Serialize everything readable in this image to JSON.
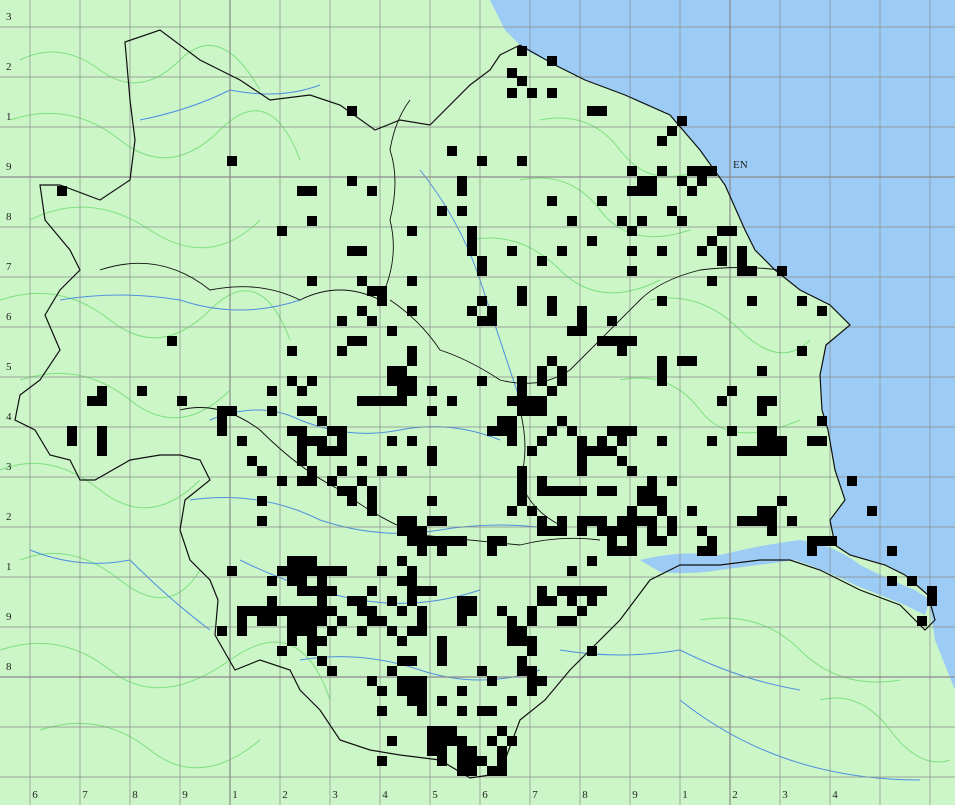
{
  "map": {
    "colors": {
      "land": "#ccf5c8",
      "sea": "#9cccf5",
      "contour": "#7fe07f",
      "river": "#4f8fe0",
      "grid": "#8a8a8a",
      "boundary": "#111111",
      "record": "#000000"
    },
    "x_ticks": [
      "6",
      "7",
      "8",
      "9",
      "1",
      "2",
      "3",
      "4",
      "5",
      "6",
      "7",
      "8",
      "9",
      "1",
      "2",
      "3",
      "4"
    ],
    "y_ticks": [
      "3",
      "2",
      "1",
      "9",
      "8",
      "7",
      "6",
      "5",
      "4",
      "3",
      "2",
      "1",
      "9",
      "8"
    ],
    "sea_label": "EN"
  },
  "records": [
    [
      522,
      51
    ],
    [
      552,
      61
    ],
    [
      512,
      73
    ],
    [
      522,
      81
    ],
    [
      512,
      93
    ],
    [
      532,
      93
    ],
    [
      552,
      93
    ],
    [
      352,
      111
    ],
    [
      592,
      111
    ],
    [
      602,
      111
    ],
    [
      682,
      121
    ],
    [
      672,
      131
    ],
    [
      662,
      141
    ],
    [
      452,
      151
    ],
    [
      232,
      161
    ],
    [
      482,
      161
    ],
    [
      522,
      161
    ],
    [
      632,
      171
    ],
    [
      662,
      171
    ],
    [
      692,
      171
    ],
    [
      702,
      171
    ],
    [
      712,
      171
    ],
    [
      352,
      181
    ],
    [
      462,
      181
    ],
    [
      642,
      181
    ],
    [
      652,
      181
    ],
    [
      682,
      181
    ],
    [
      702,
      181
    ],
    [
      62,
      191
    ],
    [
      302,
      191
    ],
    [
      312,
      191
    ],
    [
      372,
      191
    ],
    [
      462,
      191
    ],
    [
      632,
      191
    ],
    [
      642,
      191
    ],
    [
      652,
      191
    ],
    [
      692,
      191
    ],
    [
      552,
      201
    ],
    [
      602,
      201
    ],
    [
      462,
      211
    ],
    [
      442,
      211
    ],
    [
      672,
      211
    ],
    [
      312,
      221
    ],
    [
      572,
      221
    ],
    [
      622,
      221
    ],
    [
      642,
      221
    ],
    [
      682,
      221
    ],
    [
      412,
      231
    ],
    [
      282,
      231
    ],
    [
      472,
      231
    ],
    [
      722,
      231
    ],
    [
      732,
      231
    ],
    [
      632,
      231
    ],
    [
      592,
      241
    ],
    [
      472,
      241
    ],
    [
      712,
      241
    ],
    [
      352,
      251
    ],
    [
      362,
      251
    ],
    [
      472,
      251
    ],
    [
      512,
      251
    ],
    [
      562,
      251
    ],
    [
      632,
      251
    ],
    [
      662,
      251
    ],
    [
      702,
      251
    ],
    [
      722,
      251
    ],
    [
      742,
      251
    ],
    [
      482,
      261
    ],
    [
      542,
      261
    ],
    [
      722,
      261
    ],
    [
      742,
      261
    ],
    [
      482,
      271
    ],
    [
      632,
      271
    ],
    [
      742,
      271
    ],
    [
      752,
      271
    ],
    [
      782,
      271
    ],
    [
      362,
      281
    ],
    [
      312,
      281
    ],
    [
      712,
      281
    ],
    [
      412,
      281
    ],
    [
      372,
      291
    ],
    [
      382,
      291
    ],
    [
      522,
      291
    ],
    [
      382,
      301
    ],
    [
      482,
      301
    ],
    [
      522,
      301
    ],
    [
      552,
      301
    ],
    [
      752,
      301
    ],
    [
      802,
      301
    ],
    [
      662,
      301
    ],
    [
      362,
      311
    ],
    [
      412,
      311
    ],
    [
      472,
      311
    ],
    [
      492,
      311
    ],
    [
      552,
      311
    ],
    [
      582,
      311
    ],
    [
      822,
      311
    ],
    [
      342,
      321
    ],
    [
      372,
      321
    ],
    [
      482,
      321
    ],
    [
      492,
      321
    ],
    [
      582,
      321
    ],
    [
      612,
      321
    ],
    [
      392,
      331
    ],
    [
      572,
      331
    ],
    [
      582,
      331
    ],
    [
      352,
      341
    ],
    [
      362,
      341
    ],
    [
      602,
      341
    ],
    [
      612,
      341
    ],
    [
      622,
      341
    ],
    [
      632,
      341
    ],
    [
      172,
      341
    ],
    [
      292,
      351
    ],
    [
      342,
      351
    ],
    [
      412,
      351
    ],
    [
      622,
      351
    ],
    [
      802,
      351
    ],
    [
      412,
      361
    ],
    [
      552,
      361
    ],
    [
      662,
      361
    ],
    [
      682,
      361
    ],
    [
      692,
      361
    ],
    [
      392,
      371
    ],
    [
      402,
      371
    ],
    [
      542,
      371
    ],
    [
      562,
      371
    ],
    [
      662,
      371
    ],
    [
      762,
      371
    ],
    [
      292,
      381
    ],
    [
      312,
      381
    ],
    [
      392,
      381
    ],
    [
      402,
      381
    ],
    [
      412,
      381
    ],
    [
      482,
      381
    ],
    [
      522,
      381
    ],
    [
      542,
      381
    ],
    [
      562,
      381
    ],
    [
      662,
      381
    ],
    [
      102,
      391
    ],
    [
      142,
      391
    ],
    [
      272,
      391
    ],
    [
      302,
      391
    ],
    [
      402,
      391
    ],
    [
      412,
      391
    ],
    [
      432,
      391
    ],
    [
      522,
      391
    ],
    [
      552,
      391
    ],
    [
      732,
      391
    ],
    [
      92,
      401
    ],
    [
      102,
      401
    ],
    [
      182,
      401
    ],
    [
      362,
      401
    ],
    [
      372,
      401
    ],
    [
      382,
      401
    ],
    [
      392,
      401
    ],
    [
      402,
      401
    ],
    [
      452,
      401
    ],
    [
      512,
      401
    ],
    [
      522,
      401
    ],
    [
      532,
      401
    ],
    [
      542,
      401
    ],
    [
      722,
      401
    ],
    [
      762,
      401
    ],
    [
      772,
      401
    ],
    [
      222,
      411
    ],
    [
      232,
      411
    ],
    [
      272,
      411
    ],
    [
      302,
      411
    ],
    [
      312,
      411
    ],
    [
      432,
      411
    ],
    [
      522,
      411
    ],
    [
      532,
      411
    ],
    [
      542,
      411
    ],
    [
      762,
      411
    ],
    [
      222,
      421
    ],
    [
      322,
      421
    ],
    [
      502,
      421
    ],
    [
      512,
      421
    ],
    [
      562,
      421
    ],
    [
      822,
      421
    ],
    [
      222,
      431
    ],
    [
      292,
      431
    ],
    [
      302,
      431
    ],
    [
      332,
      431
    ],
    [
      342,
      431
    ],
    [
      492,
      431
    ],
    [
      502,
      431
    ],
    [
      512,
      431
    ],
    [
      552,
      431
    ],
    [
      572,
      431
    ],
    [
      612,
      431
    ],
    [
      622,
      431
    ],
    [
      632,
      431
    ],
    [
      732,
      431
    ],
    [
      762,
      431
    ],
    [
      772,
      431
    ],
    [
      72,
      431
    ],
    [
      102,
      431
    ],
    [
      72,
      441
    ],
    [
      102,
      441
    ],
    [
      242,
      441
    ],
    [
      302,
      441
    ],
    [
      312,
      441
    ],
    [
      322,
      441
    ],
    [
      342,
      441
    ],
    [
      392,
      441
    ],
    [
      412,
      441
    ],
    [
      512,
      441
    ],
    [
      542,
      441
    ],
    [
      582,
      441
    ],
    [
      602,
      441
    ],
    [
      622,
      441
    ],
    [
      662,
      441
    ],
    [
      712,
      441
    ],
    [
      762,
      441
    ],
    [
      772,
      441
    ],
    [
      782,
      441
    ],
    [
      812,
      441
    ],
    [
      822,
      441
    ],
    [
      102,
      451
    ],
    [
      302,
      451
    ],
    [
      322,
      451
    ],
    [
      332,
      451
    ],
    [
      342,
      451
    ],
    [
      432,
      451
    ],
    [
      532,
      451
    ],
    [
      582,
      451
    ],
    [
      592,
      451
    ],
    [
      602,
      451
    ],
    [
      612,
      451
    ],
    [
      742,
      451
    ],
    [
      752,
      451
    ],
    [
      762,
      451
    ],
    [
      772,
      451
    ],
    [
      782,
      451
    ],
    [
      252,
      461
    ],
    [
      302,
      461
    ],
    [
      362,
      461
    ],
    [
      432,
      461
    ],
    [
      582,
      461
    ],
    [
      622,
      461
    ],
    [
      262,
      471
    ],
    [
      312,
      471
    ],
    [
      342,
      471
    ],
    [
      382,
      471
    ],
    [
      402,
      471
    ],
    [
      522,
      471
    ],
    [
      582,
      471
    ],
    [
      632,
      471
    ],
    [
      282,
      481
    ],
    [
      302,
      481
    ],
    [
      312,
      481
    ],
    [
      332,
      481
    ],
    [
      362,
      481
    ],
    [
      522,
      481
    ],
    [
      542,
      481
    ],
    [
      652,
      481
    ],
    [
      672,
      481
    ],
    [
      852,
      481
    ],
    [
      342,
      491
    ],
    [
      352,
      491
    ],
    [
      372,
      491
    ],
    [
      522,
      491
    ],
    [
      542,
      491
    ],
    [
      552,
      491
    ],
    [
      562,
      491
    ],
    [
      572,
      491
    ],
    [
      582,
      491
    ],
    [
      602,
      491
    ],
    [
      612,
      491
    ],
    [
      642,
      491
    ],
    [
      652,
      491
    ],
    [
      262,
      501
    ],
    [
      352,
      501
    ],
    [
      372,
      501
    ],
    [
      432,
      501
    ],
    [
      522,
      501
    ],
    [
      642,
      501
    ],
    [
      652,
      501
    ],
    [
      662,
      501
    ],
    [
      782,
      501
    ],
    [
      372,
      511
    ],
    [
      512,
      511
    ],
    [
      532,
      511
    ],
    [
      632,
      511
    ],
    [
      662,
      511
    ],
    [
      692,
      511
    ],
    [
      762,
      511
    ],
    [
      772,
      511
    ],
    [
      872,
      511
    ],
    [
      262,
      521
    ],
    [
      402,
      521
    ],
    [
      412,
      521
    ],
    [
      432,
      521
    ],
    [
      442,
      521
    ],
    [
      542,
      521
    ],
    [
      562,
      521
    ],
    [
      582,
      521
    ],
    [
      592,
      521
    ],
    [
      602,
      521
    ],
    [
      622,
      521
    ],
    [
      632,
      521
    ],
    [
      642,
      521
    ],
    [
      652,
      521
    ],
    [
      672,
      521
    ],
    [
      742,
      521
    ],
    [
      752,
      521
    ],
    [
      762,
      521
    ],
    [
      772,
      521
    ],
    [
      792,
      521
    ],
    [
      402,
      531
    ],
    [
      412,
      531
    ],
    [
      422,
      531
    ],
    [
      542,
      531
    ],
    [
      552,
      531
    ],
    [
      562,
      531
    ],
    [
      582,
      531
    ],
    [
      602,
      531
    ],
    [
      612,
      531
    ],
    [
      622,
      531
    ],
    [
      632,
      531
    ],
    [
      652,
      531
    ],
    [
      672,
      531
    ],
    [
      702,
      531
    ],
    [
      772,
      531
    ],
    [
      412,
      541
    ],
    [
      422,
      541
    ],
    [
      432,
      541
    ],
    [
      442,
      541
    ],
    [
      452,
      541
    ],
    [
      462,
      541
    ],
    [
      492,
      541
    ],
    [
      502,
      541
    ],
    [
      612,
      541
    ],
    [
      632,
      541
    ],
    [
      652,
      541
    ],
    [
      662,
      541
    ],
    [
      712,
      541
    ],
    [
      812,
      541
    ],
    [
      822,
      541
    ],
    [
      832,
      541
    ],
    [
      422,
      551
    ],
    [
      442,
      551
    ],
    [
      492,
      551
    ],
    [
      612,
      551
    ],
    [
      622,
      551
    ],
    [
      632,
      551
    ],
    [
      702,
      551
    ],
    [
      712,
      551
    ],
    [
      812,
      551
    ],
    [
      892,
      551
    ],
    [
      292,
      561
    ],
    [
      302,
      561
    ],
    [
      312,
      561
    ],
    [
      402,
      561
    ],
    [
      592,
      561
    ],
    [
      232,
      571
    ],
    [
      282,
      571
    ],
    [
      292,
      571
    ],
    [
      302,
      571
    ],
    [
      312,
      571
    ],
    [
      322,
      571
    ],
    [
      332,
      571
    ],
    [
      342,
      571
    ],
    [
      382,
      571
    ],
    [
      412,
      571
    ],
    [
      572,
      571
    ],
    [
      272,
      581
    ],
    [
      292,
      581
    ],
    [
      302,
      581
    ],
    [
      322,
      581
    ],
    [
      402,
      581
    ],
    [
      412,
      581
    ],
    [
      892,
      581
    ],
    [
      912,
      581
    ],
    [
      302,
      591
    ],
    [
      312,
      591
    ],
    [
      322,
      591
    ],
    [
      332,
      591
    ],
    [
      372,
      591
    ],
    [
      412,
      591
    ],
    [
      422,
      591
    ],
    [
      432,
      591
    ],
    [
      542,
      591
    ],
    [
      562,
      591
    ],
    [
      572,
      591
    ],
    [
      582,
      591
    ],
    [
      592,
      591
    ],
    [
      602,
      591
    ],
    [
      932,
      591
    ],
    [
      272,
      601
    ],
    [
      322,
      601
    ],
    [
      352,
      601
    ],
    [
      362,
      601
    ],
    [
      392,
      601
    ],
    [
      412,
      601
    ],
    [
      462,
      601
    ],
    [
      472,
      601
    ],
    [
      542,
      601
    ],
    [
      552,
      601
    ],
    [
      572,
      601
    ],
    [
      592,
      601
    ],
    [
      932,
      601
    ],
    [
      242,
      611
    ],
    [
      252,
      611
    ],
    [
      262,
      611
    ],
    [
      272,
      611
    ],
    [
      282,
      611
    ],
    [
      292,
      611
    ],
    [
      302,
      611
    ],
    [
      312,
      611
    ],
    [
      322,
      611
    ],
    [
      332,
      611
    ],
    [
      362,
      611
    ],
    [
      372,
      611
    ],
    [
      402,
      611
    ],
    [
      422,
      611
    ],
    [
      462,
      611
    ],
    [
      472,
      611
    ],
    [
      502,
      611
    ],
    [
      532,
      611
    ],
    [
      582,
      611
    ],
    [
      242,
      621
    ],
    [
      262,
      621
    ],
    [
      272,
      621
    ],
    [
      292,
      621
    ],
    [
      302,
      621
    ],
    [
      312,
      621
    ],
    [
      322,
      621
    ],
    [
      342,
      621
    ],
    [
      372,
      621
    ],
    [
      382,
      621
    ],
    [
      422,
      621
    ],
    [
      462,
      621
    ],
    [
      512,
      621
    ],
    [
      532,
      621
    ],
    [
      562,
      621
    ],
    [
      572,
      621
    ],
    [
      922,
      621
    ],
    [
      222,
      631
    ],
    [
      242,
      631
    ],
    [
      292,
      631
    ],
    [
      302,
      631
    ],
    [
      312,
      631
    ],
    [
      332,
      631
    ],
    [
      362,
      631
    ],
    [
      392,
      631
    ],
    [
      412,
      631
    ],
    [
      422,
      631
    ],
    [
      512,
      631
    ],
    [
      522,
      631
    ],
    [
      292,
      641
    ],
    [
      312,
      641
    ],
    [
      322,
      641
    ],
    [
      402,
      641
    ],
    [
      442,
      641
    ],
    [
      512,
      641
    ],
    [
      522,
      641
    ],
    [
      532,
      641
    ],
    [
      282,
      651
    ],
    [
      312,
      651
    ],
    [
      442,
      651
    ],
    [
      532,
      651
    ],
    [
      592,
      651
    ],
    [
      322,
      661
    ],
    [
      402,
      661
    ],
    [
      412,
      661
    ],
    [
      442,
      661
    ],
    [
      522,
      661
    ],
    [
      332,
      671
    ],
    [
      392,
      671
    ],
    [
      482,
      671
    ],
    [
      522,
      671
    ],
    [
      532,
      671
    ],
    [
      372,
      681
    ],
    [
      402,
      681
    ],
    [
      412,
      681
    ],
    [
      422,
      681
    ],
    [
      492,
      681
    ],
    [
      532,
      681
    ],
    [
      542,
      681
    ],
    [
      382,
      691
    ],
    [
      402,
      691
    ],
    [
      412,
      691
    ],
    [
      422,
      691
    ],
    [
      462,
      691
    ],
    [
      532,
      691
    ],
    [
      412,
      701
    ],
    [
      422,
      701
    ],
    [
      442,
      701
    ],
    [
      512,
      701
    ],
    [
      382,
      711
    ],
    [
      422,
      711
    ],
    [
      462,
      711
    ],
    [
      482,
      711
    ],
    [
      492,
      711
    ],
    [
      432,
      731
    ],
    [
      442,
      731
    ],
    [
      452,
      731
    ],
    [
      502,
      731
    ],
    [
      392,
      741
    ],
    [
      432,
      741
    ],
    [
      442,
      741
    ],
    [
      452,
      741
    ],
    [
      462,
      741
    ],
    [
      492,
      741
    ],
    [
      512,
      741
    ],
    [
      432,
      751
    ],
    [
      442,
      751
    ],
    [
      462,
      751
    ],
    [
      472,
      751
    ],
    [
      502,
      751
    ],
    [
      382,
      761
    ],
    [
      442,
      761
    ],
    [
      462,
      761
    ],
    [
      472,
      761
    ],
    [
      482,
      761
    ],
    [
      502,
      761
    ],
    [
      462,
      771
    ],
    [
      472,
      771
    ],
    [
      492,
      771
    ],
    [
      502,
      771
    ]
  ]
}
